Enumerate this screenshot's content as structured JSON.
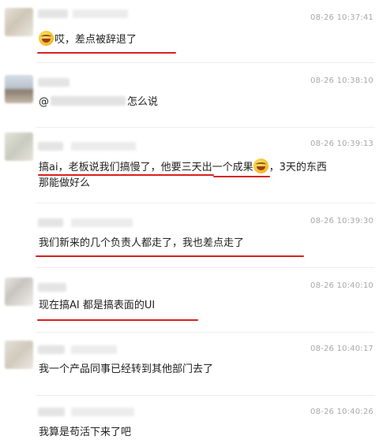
{
  "messages": [
    {
      "time": "08-26 10:37:41",
      "text": "哎，差点被辞退了",
      "emoji_before": true
    },
    {
      "time": "08-26 10:38:10",
      "mention_prefix": "@",
      "text": "怎么说"
    },
    {
      "time": "08-26 10:39:13",
      "line1_part1": "搞ai，老板说我们搞慢了，他要三天出一个成果",
      "line1_part2": "，3天的东西",
      "line2": "那能做好么"
    },
    {
      "time": "08-26 10:39:30",
      "text": "我们新来的几个负责人都走了，我也差点走了"
    },
    {
      "time": "08-26 10:40:10",
      "text": "现在搞AI 都是搞表面的UI"
    },
    {
      "time": "08-26 10:40:17",
      "text": "我一个产品同事已经转到其他部门去了"
    },
    {
      "time": "08-26 10:40:26",
      "text": "我算是苟活下来了吧"
    }
  ],
  "colors": {
    "highlight_underline": "#d92020",
    "timestamp": "#a8a8a8",
    "text": "#222222"
  },
  "icons": [
    "laughing-crying-emoji-icon"
  ]
}
